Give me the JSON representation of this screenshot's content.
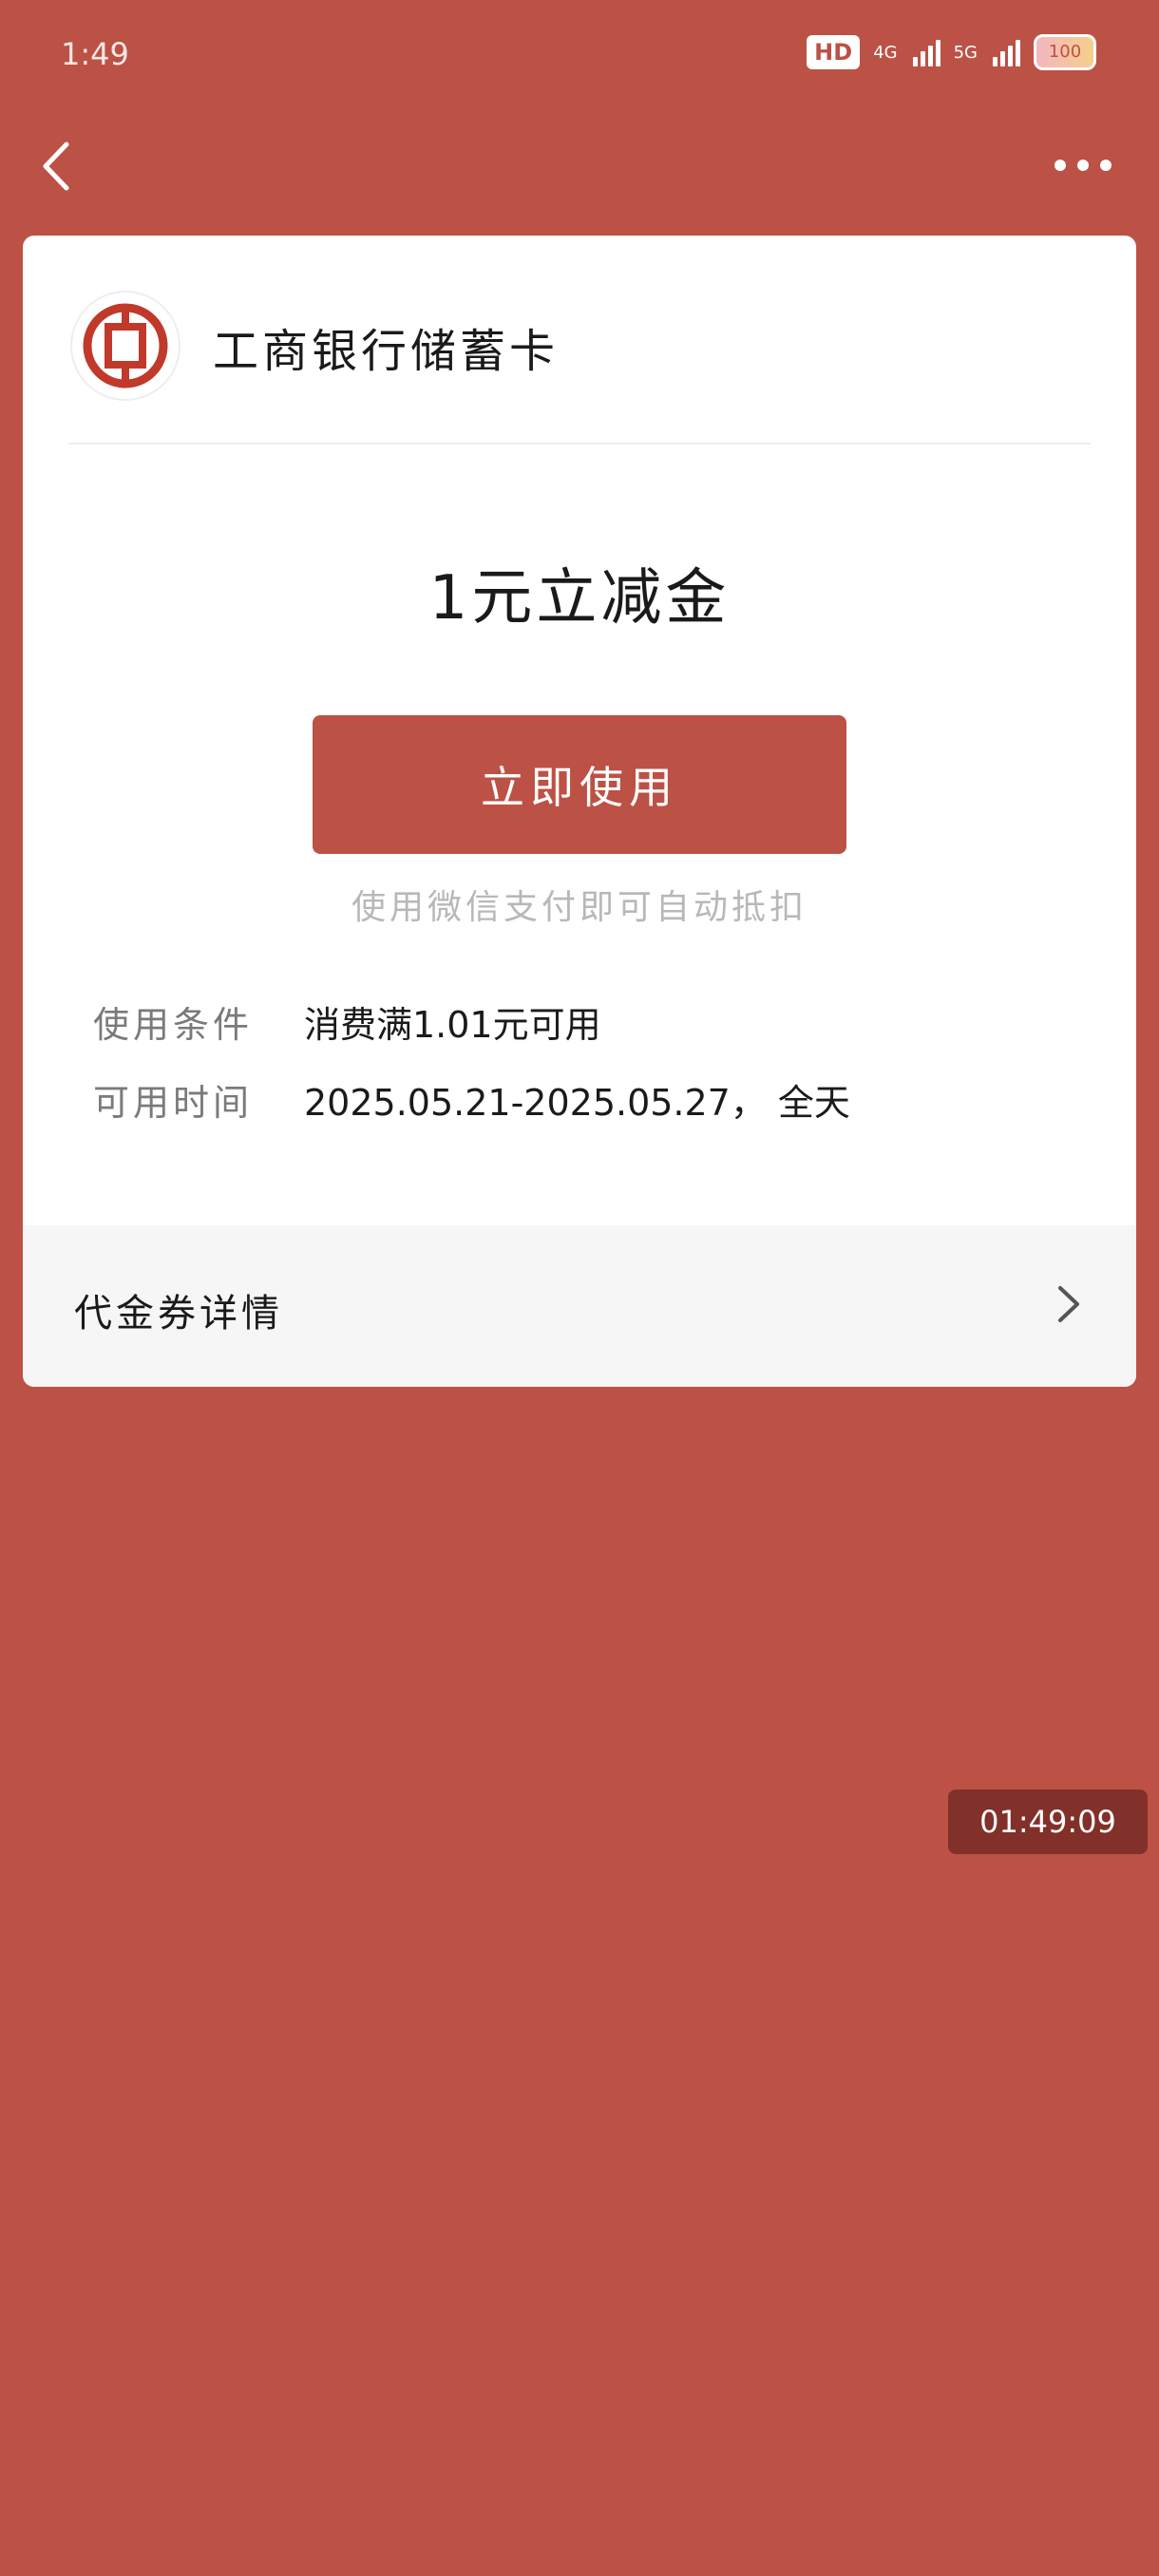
{
  "status_bar": {
    "time": "1:49",
    "hd_label": "HD",
    "network_1": "4G",
    "network_2": "5G",
    "battery": "100"
  },
  "nav": {
    "back_icon": "chevron-left-icon",
    "more_icon": "more-dots-icon"
  },
  "card": {
    "bank_name": "工商银行储蓄卡",
    "coupon_title": "1元立减金",
    "use_button_label": "立即使用",
    "use_hint": "使用微信支付即可自动抵扣",
    "conditions_label": "使用条件",
    "conditions_value": "消费满1.01元可用",
    "validity_label": "可用时间",
    "validity_value": "2025.05.21-2025.05.27， 全天",
    "details_label": "代金券详情"
  },
  "overlay": {
    "timestamp": "01:49:09"
  },
  "colors": {
    "background": "#BC5145",
    "button": "#BC5145",
    "card": "#FFFFFF",
    "overlay": "#82302A"
  }
}
